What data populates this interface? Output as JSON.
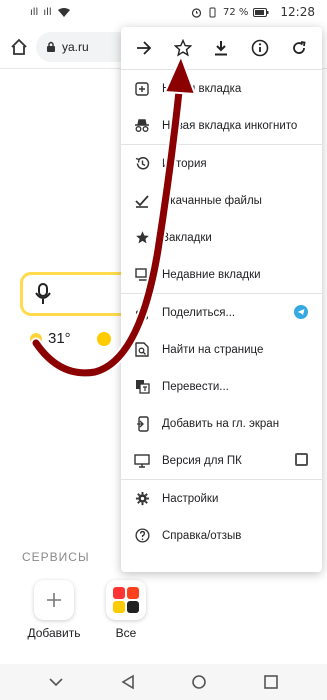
{
  "status_bar": {
    "signal1": "ıll",
    "signal2": "ıll",
    "battery": "72 %",
    "time": "12:28"
  },
  "toolbar": {
    "url": "ya.ru"
  },
  "page": {
    "temperature": "31°",
    "services_label": "СЕРВИСЫ",
    "add_label": "Добавить",
    "all_label": "Все"
  },
  "menu": {
    "top_icons": [
      "forward-icon",
      "star-icon",
      "download-icon",
      "info-icon",
      "reload-icon"
    ],
    "items": [
      {
        "icon": "new-tab-icon",
        "label": "Новая вкладка"
      },
      {
        "icon": "incognito-icon",
        "label": "Новая вкладка инкогнито"
      },
      {
        "icon": "history-icon",
        "label": "История"
      },
      {
        "icon": "downloads-icon",
        "label": "Скачанные файлы"
      },
      {
        "icon": "bookmarks-icon",
        "label": "Закладки"
      },
      {
        "icon": "recent-tabs-icon",
        "label": "Недавние вкладки"
      },
      {
        "icon": "share-icon",
        "label": "Поделиться..."
      },
      {
        "icon": "find-icon",
        "label": "Найти на странице"
      },
      {
        "icon": "translate-icon",
        "label": "Перевести..."
      },
      {
        "icon": "add-home-icon",
        "label": "Добавить на гл. экран"
      },
      {
        "icon": "desktop-icon",
        "label": "Версия для ПК"
      },
      {
        "icon": "settings-icon",
        "label": "Настройки"
      },
      {
        "icon": "help-icon",
        "label": "Справка/отзыв"
      }
    ]
  },
  "colors": {
    "accent_yellow": "#ffdb4d",
    "arrow_red": "#8b0000",
    "telegram_blue": "#35a9e1"
  }
}
